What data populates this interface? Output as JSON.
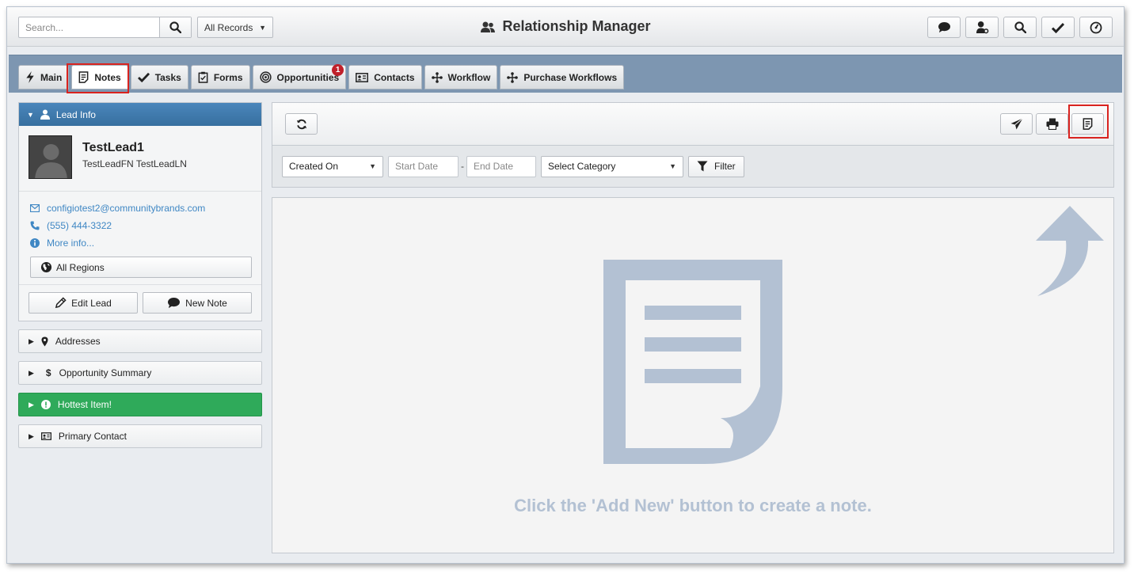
{
  "header": {
    "search_placeholder": "Search...",
    "records_filter": "All Records",
    "app_title": "Relationship Manager",
    "icons": [
      "chat-icon",
      "user-settings-icon",
      "search-icon",
      "check-icon",
      "dashboard-icon"
    ]
  },
  "tabs": [
    {
      "label": "Main",
      "icon": "bolt-icon"
    },
    {
      "label": "Notes",
      "icon": "note-icon",
      "active": true
    },
    {
      "label": "Tasks",
      "icon": "check-icon"
    },
    {
      "label": "Forms",
      "icon": "clipboard-icon"
    },
    {
      "label": "Opportunities",
      "icon": "target-icon",
      "badge": "1"
    },
    {
      "label": "Contacts",
      "icon": "id-card-icon"
    },
    {
      "label": "Workflow",
      "icon": "workflow-icon"
    },
    {
      "label": "Purchase Workflows",
      "icon": "workflow-icon"
    }
  ],
  "lead": {
    "section_title": "Lead Info",
    "name": "TestLead1",
    "full_name": "TestLeadFN TestLeadLN",
    "email": "configiotest2@communitybrands.com",
    "phone": "(555) 444-3322",
    "more_info": "More info...",
    "regions_button": "All Regions",
    "edit_button": "Edit Lead",
    "new_note_button": "New Note"
  },
  "accordions": {
    "addresses": "Addresses",
    "opportunity_summary": "Opportunity Summary",
    "hottest_item": "Hottest Item!",
    "primary_contact": "Primary Contact"
  },
  "filters": {
    "sort_field": "Created On",
    "start_date_placeholder": "Start Date",
    "separator": "-",
    "end_date_placeholder": "End Date",
    "category": "Select Category",
    "filter_button": "Filter"
  },
  "notes": {
    "empty_message": "Click the 'Add New' button to create a note."
  },
  "colors": {
    "tabbar": "#7d96b1",
    "lead_header": "#3f7aaf",
    "link": "#3f87c4",
    "hottest": "#2faa5a",
    "highlight": "#d9231f",
    "placeholder_art": "#b3c1d3",
    "badge": "#c0202a"
  }
}
